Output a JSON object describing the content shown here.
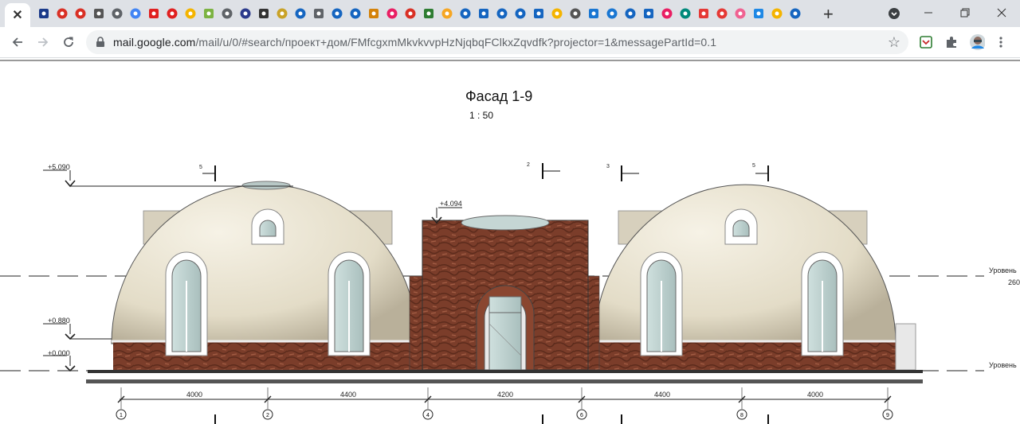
{
  "browser": {
    "active_tab_close": "✕",
    "new_tab": "+",
    "url_host": "mail.google.com",
    "url_path": "/mail/u/0/#search/проект+дом/FMfcgxmMkvkvvpHzNjqbqFClkxZqvdfk?projector=1&messagePartId=0.1",
    "tab_icons": [
      "app-icon",
      "gmail-icon",
      "gmail-icon",
      "extension-icon",
      "globe-icon",
      "docs-icon",
      "opera-icon",
      "opera-icon",
      "info-icon",
      "triangle-icon",
      "globe-icon",
      "w-icon",
      "wikipedia-icon",
      "shield-icon",
      "arrow-icon",
      "globe-icon",
      "list-icon",
      "list-icon",
      "arch-icon",
      "circle-icon",
      "gmail-icon",
      "gear-icon",
      "hand-icon",
      "flag-icon",
      "arrow-icon",
      "arrow-icon",
      "arrow-icon",
      "arrow-icon",
      "sun-icon",
      "extension-icon",
      "book-icon",
      "book-icon",
      "arrow-icon",
      "fp-icon",
      "a-icon",
      "owl-icon",
      "h-icon",
      "h-icon",
      "ball-icon",
      "planet-icon",
      "in-icon",
      "fp-icon"
    ],
    "tab_icon_colors": [
      "#1a3a8a",
      "#d93025",
      "#d93025",
      "#555",
      "#5f6368",
      "#4285f4",
      "#e02020",
      "#e02020",
      "#f4b400",
      "#7cb342",
      "#5f6368",
      "#2b3a8c",
      "#333",
      "#c9a227",
      "#1565c0",
      "#5f6368",
      "#1565c0",
      "#1565c0",
      "#d4820a",
      "#e91e63",
      "#d93025",
      "#2e7d32",
      "#f6a623",
      "#1565c0",
      "#1565c0",
      "#1565c0",
      "#1565c0",
      "#1565c0",
      "#f4b400",
      "#555",
      "#1976d2",
      "#1976d2",
      "#1565c0",
      "#1565c0",
      "#e91e63",
      "#00897b",
      "#e53935",
      "#e53935",
      "#f06292",
      "#1e88e5",
      "#f4b400",
      "#1565c0"
    ]
  },
  "drawing": {
    "title": "Фасад 1-9",
    "scale": "1 : 50",
    "levels": [
      {
        "label": "+5.090"
      },
      {
        "label": "+4.094"
      },
      {
        "label": "+0.880"
      },
      {
        "label": "+0.000"
      }
    ],
    "level_right_1": "Уровень",
    "level_right_1_value": "260",
    "level_right_2": "Уровень",
    "section_marks": [
      "5",
      "2",
      "3",
      "5"
    ],
    "dimensions": [
      "4000",
      "4400",
      "4200",
      "4400",
      "4000"
    ],
    "axes": [
      "1",
      "2",
      "4",
      "6",
      "8",
      "9"
    ]
  },
  "colors": {
    "dome": "#e7e1cf",
    "brick": "#7a3b28",
    "glass": "#bfd0cf",
    "frame": "#ffffff"
  }
}
